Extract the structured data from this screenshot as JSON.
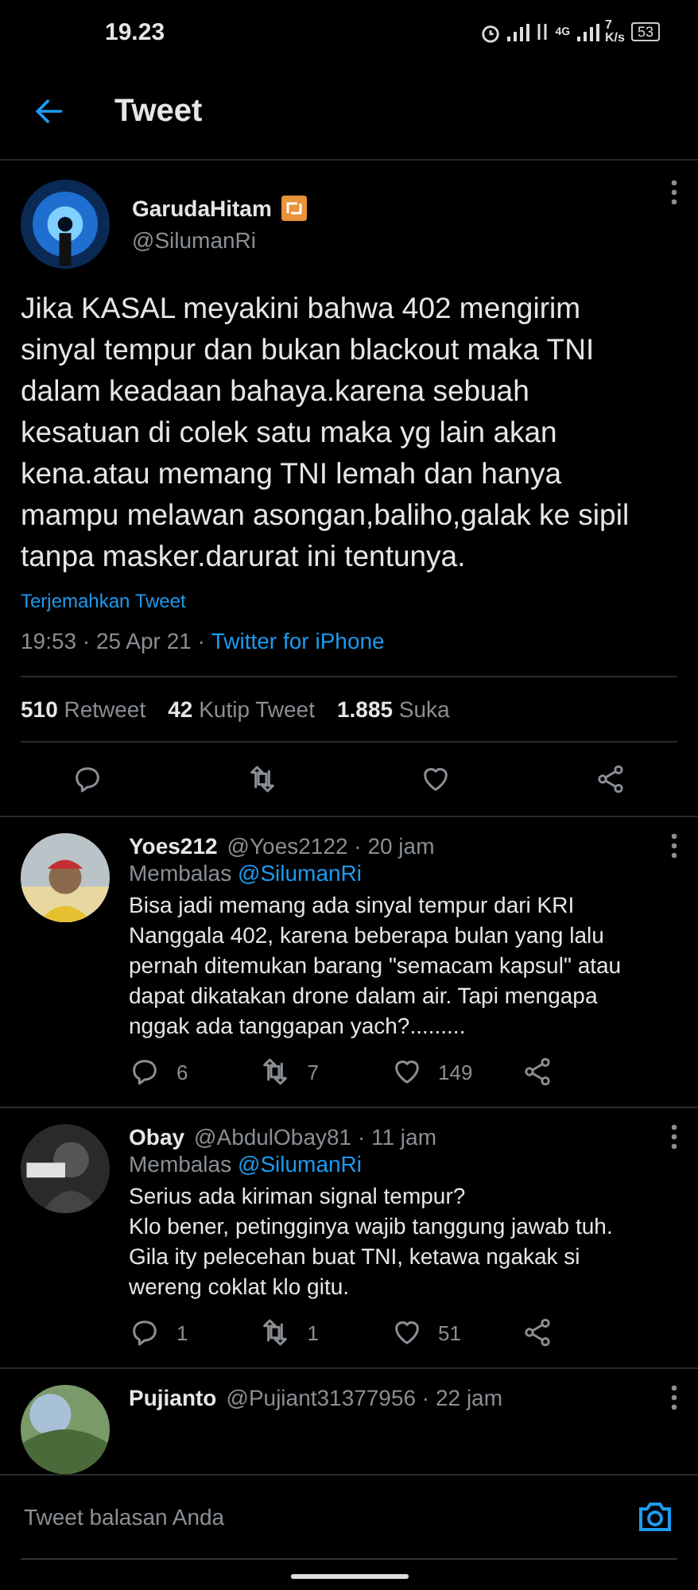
{
  "status_bar": {
    "time": "19.23",
    "network_type": "4G",
    "speed": "7",
    "speed_unit": "K/s",
    "battery": "53"
  },
  "header": {
    "title": "Tweet"
  },
  "tweet": {
    "name": "GarudaHitam",
    "handle": "@SilumanRi",
    "text": "Jika KASAL meyakini bahwa 402 mengirim sinyal tempur dan bukan blackout maka TNI dalam keadaan bahaya.karena sebuah kesatuan di colek satu maka yg lain akan kena.atau memang TNI lemah dan hanya mampu melawan asongan,baliho,galak ke sipil tanpa masker.darurat ini tentunya.",
    "translate": "Terjemahkan Tweet",
    "time": "19:53 · 25 Apr 21 · ",
    "source": "Twitter for iPhone",
    "stats": [
      {
        "count": "510",
        "label": "Retweet"
      },
      {
        "count": "42",
        "label": "Kutip Tweet"
      },
      {
        "count": "1.885",
        "label": "Suka"
      }
    ]
  },
  "replies": [
    {
      "name": "Yoes212",
      "handle": "@Yoes2122 · 20 jam",
      "replying_label": "Membalas",
      "replying_to": "@SilumanRi",
      "text": "Bisa jadi memang ada sinyal tempur dari KRI Nanggala 402, karena beberapa bulan yang lalu pernah ditemukan barang \"semacam kapsul\" atau dapat dikatakan drone dalam air. Tapi mengapa nggak ada tanggapan yach?.........",
      "replies": "6",
      "retweets": "7",
      "likes": "149"
    },
    {
      "name": "Obay",
      "handle": "@AbdulObay81 · 11 jam",
      "replying_label": "Membalas",
      "replying_to": "@SilumanRi",
      "text": "Serius ada kiriman signal tempur?\nKlo bener, petingginya wajib tanggung jawab tuh. Gila ity pelecehan buat TNI, ketawa ngakak si wereng coklat klo gitu.",
      "replies": "1",
      "retweets": "1",
      "likes": "51"
    },
    {
      "name": "Pujianto",
      "handle": "@Pujiant31377956 · 22 jam"
    }
  ],
  "reply_bar": {
    "placeholder": "Tweet balasan Anda"
  }
}
